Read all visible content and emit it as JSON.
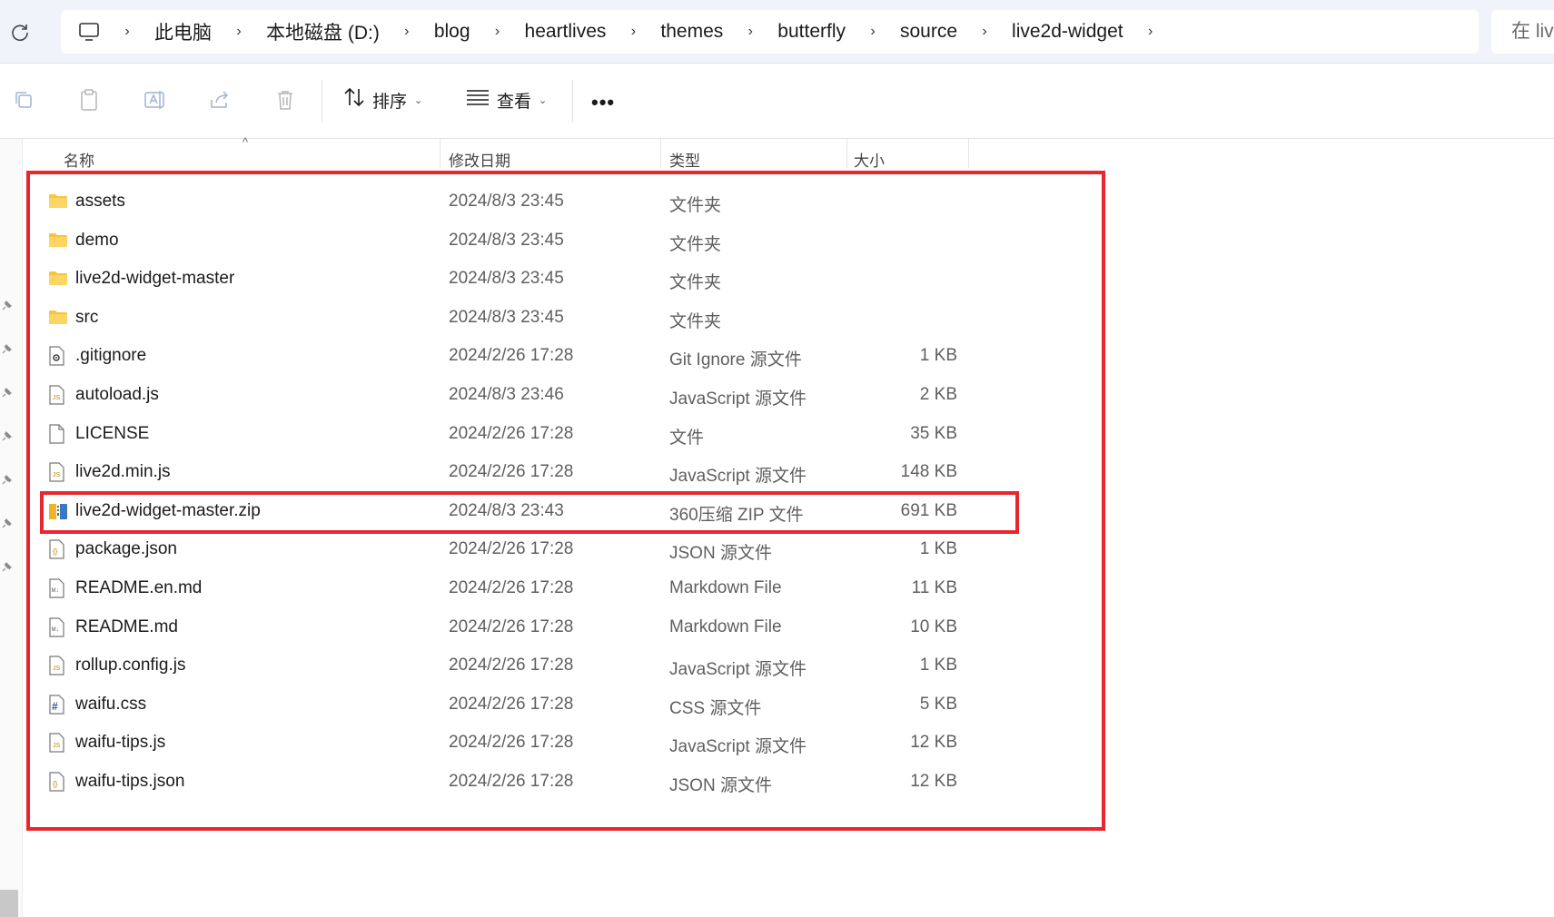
{
  "breadcrumb": [
    "此电脑",
    "本地磁盘 (D:)",
    "blog",
    "heartlives",
    "themes",
    "butterfly",
    "source",
    "live2d-widget"
  ],
  "search": {
    "text": "在 live"
  },
  "toolbar": {
    "sort_label": "排序",
    "view_label": "查看",
    "more_label": "•••"
  },
  "columns": {
    "name": "名称",
    "date": "修改日期",
    "type": "类型",
    "size": "大小"
  },
  "files": [
    {
      "name": "assets",
      "date": "2024/8/3 23:45",
      "type": "文件夹",
      "size": "",
      "icon": "folder-icon"
    },
    {
      "name": "demo",
      "date": "2024/8/3 23:45",
      "type": "文件夹",
      "size": "",
      "icon": "folder-icon"
    },
    {
      "name": "live2d-widget-master",
      "date": "2024/8/3 23:45",
      "type": "文件夹",
      "size": "",
      "icon": "folder-icon"
    },
    {
      "name": "src",
      "date": "2024/8/3 23:45",
      "type": "文件夹",
      "size": "",
      "icon": "folder-icon"
    },
    {
      "name": ".gitignore",
      "date": "2024/2/26 17:28",
      "type": "Git Ignore 源文件",
      "size": "1 KB",
      "icon": "settings-file-icon"
    },
    {
      "name": "autoload.js",
      "date": "2024/8/3 23:46",
      "type": "JavaScript 源文件",
      "size": "2 KB",
      "icon": "js-file-icon"
    },
    {
      "name": "LICENSE",
      "date": "2024/2/26 17:28",
      "type": "文件",
      "size": "35 KB",
      "icon": "blank-file-icon"
    },
    {
      "name": "live2d.min.js",
      "date": "2024/2/26 17:28",
      "type": "JavaScript 源文件",
      "size": "148 KB",
      "icon": "js-file-icon"
    },
    {
      "name": "live2d-widget-master.zip",
      "date": "2024/8/3 23:43",
      "type": "360压缩 ZIP 文件",
      "size": "691 KB",
      "icon": "zip-archive-icon"
    },
    {
      "name": "package.json",
      "date": "2024/2/26 17:28",
      "type": "JSON 源文件",
      "size": "1 KB",
      "icon": "json-file-icon"
    },
    {
      "name": "README.en.md",
      "date": "2024/2/26 17:28",
      "type": "Markdown File",
      "size": "11 KB",
      "icon": "markdown-file-icon"
    },
    {
      "name": "README.md",
      "date": "2024/2/26 17:28",
      "type": "Markdown File",
      "size": "10 KB",
      "icon": "markdown-file-icon"
    },
    {
      "name": "rollup.config.js",
      "date": "2024/2/26 17:28",
      "type": "JavaScript 源文件",
      "size": "1 KB",
      "icon": "js-file-icon"
    },
    {
      "name": "waifu.css",
      "date": "2024/2/26 17:28",
      "type": "CSS 源文件",
      "size": "5 KB",
      "icon": "css-file-icon"
    },
    {
      "name": "waifu-tips.js",
      "date": "2024/2/26 17:28",
      "type": "JavaScript 源文件",
      "size": "12 KB",
      "icon": "js-file-icon"
    },
    {
      "name": "waifu-tips.json",
      "date": "2024/2/26 17:28",
      "type": "JSON 源文件",
      "size": "12 KB",
      "icon": "json-file-icon"
    }
  ],
  "colors": {
    "highlight": "#e8262d",
    "folder": "#f8c53a",
    "accent": "#3b78c4"
  }
}
